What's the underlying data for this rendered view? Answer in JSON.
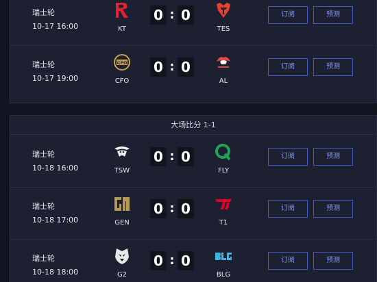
{
  "colors": {
    "background": "#121521",
    "panel": "#1d2030",
    "score_box": "#11131d",
    "button_border": "#3f59c4",
    "button_text": "#7d97f4"
  },
  "buttons": {
    "subscribe_label": "订阅",
    "predict_label": "预测"
  },
  "groups": [
    {
      "header": "",
      "matches": [
        {
          "round": "瑞士轮",
          "time": "10-17 16:00",
          "team_a": "KT",
          "team_b": "TES",
          "score_a": "0",
          "score_b": "0",
          "separator": ":",
          "logo_a": "kt-logo",
          "logo_b": "tes-logo"
        },
        {
          "round": "瑞士轮",
          "time": "10-17 19:00",
          "team_a": "CFO",
          "team_b": "AL",
          "score_a": "0",
          "score_b": "0",
          "separator": ":",
          "logo_a": "cfo-logo",
          "logo_b": "al-logo"
        }
      ]
    },
    {
      "header": "大场比分 1-1",
      "matches": [
        {
          "round": "瑞士轮",
          "time": "10-18 16:00",
          "team_a": "TSW",
          "team_b": "FLY",
          "score_a": "0",
          "score_b": "0",
          "separator": ":",
          "logo_a": "tsw-logo",
          "logo_b": "fly-logo"
        },
        {
          "round": "瑞士轮",
          "time": "10-18 17:00",
          "team_a": "GEN",
          "team_b": "T1",
          "score_a": "0",
          "score_b": "0",
          "separator": ":",
          "logo_a": "gen-logo",
          "logo_b": "t1-logo"
        },
        {
          "round": "瑞士轮",
          "time": "10-18 18:00",
          "team_a": "G2",
          "team_b": "BLG",
          "score_a": "0",
          "score_b": "0",
          "separator": ":",
          "logo_a": "g2-logo",
          "logo_b": "blg-logo"
        }
      ]
    }
  ]
}
